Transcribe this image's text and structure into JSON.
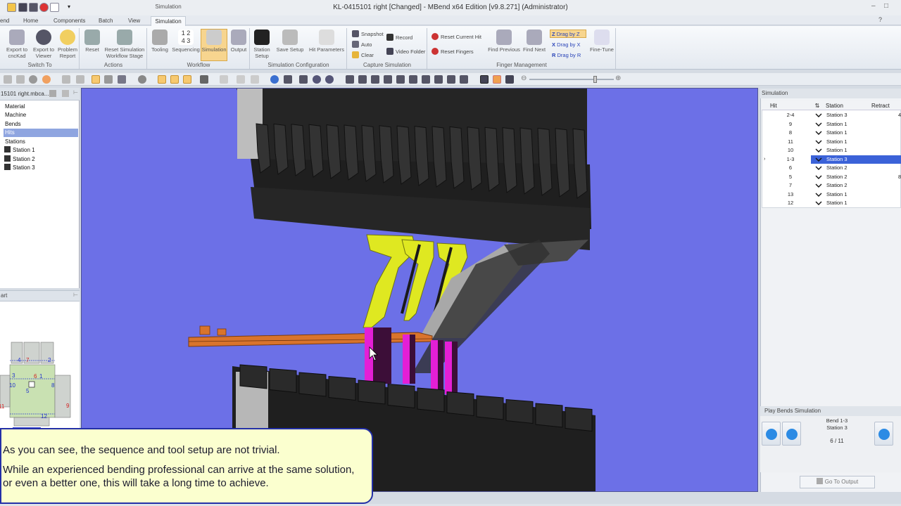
{
  "window": {
    "title": "KL-0415101 right [Changed] - MBend x64 Edition [v9.8.271] (Administrator)",
    "context_tab_label": "Simulation"
  },
  "menu_tabs": [
    "end",
    "Home",
    "Components",
    "Batch",
    "View",
    "Simulation"
  ],
  "ribbon": {
    "switch_to": {
      "label": "Switch To",
      "buttons": [
        "Export to cncKad",
        "Export to Viewer",
        "Problem Report"
      ]
    },
    "actions": {
      "label": "Actions",
      "buttons": [
        "Reset",
        "Reset Simulation Workflow Stage"
      ]
    },
    "workflow": {
      "label": "Workflow",
      "buttons": [
        "Tooling",
        "Sequencing",
        "Simulation",
        "Output"
      ]
    },
    "sim_config": {
      "label": "Simulation Configuration",
      "buttons": [
        "Station Setup",
        "Save Setup",
        "Hit Parameters"
      ]
    },
    "capture": {
      "label": "Capture Simulation",
      "buttons": [
        "Snapshot",
        "Auto",
        "Clear",
        "Record",
        "Video Folder"
      ]
    },
    "finger": {
      "label": "Finger Management",
      "buttons": [
        "Reset Current Hit",
        "Reset Fingers",
        "Find Previous",
        "Find Next",
        "Drag by Z",
        "Drag by X",
        "Drag by R",
        "Fine-Tune"
      ]
    }
  },
  "left_panel": {
    "file_name": "15101 right.mbca...",
    "tree": [
      "Material",
      "Machine",
      "Bends",
      "Hits",
      "Stations",
      "Station 1",
      "Station 2",
      "Station 3"
    ],
    "part_panel_label": "art",
    "part_numbers": [
      "4",
      "7",
      "2",
      "3",
      "6",
      "1",
      "10",
      "5",
      "8",
      "11",
      "12",
      "9"
    ]
  },
  "simulation_panel": {
    "title": "Simulation",
    "columns": [
      "Hit",
      "Station",
      "Retract"
    ],
    "rows": [
      {
        "hit": "2-4",
        "station": "Station 3",
        "retract": "4"
      },
      {
        "hit": "9",
        "station": "Station 1",
        "retract": ""
      },
      {
        "hit": "8",
        "station": "Station 1",
        "retract": ""
      },
      {
        "hit": "11",
        "station": "Station 1",
        "retract": ""
      },
      {
        "hit": "10",
        "station": "Station 1",
        "retract": ""
      },
      {
        "hit": "1-3",
        "station": "Station 3",
        "retract": ""
      },
      {
        "hit": "6",
        "station": "Station 2",
        "retract": ""
      },
      {
        "hit": "5",
        "station": "Station 2",
        "retract": "8"
      },
      {
        "hit": "7",
        "station": "Station 2",
        "retract": ""
      },
      {
        "hit": "13",
        "station": "Station 1",
        "retract": ""
      },
      {
        "hit": "12",
        "station": "Station 1",
        "retract": ""
      }
    ],
    "selected_row": 5
  },
  "play_panel": {
    "title": "Play Bends Simulation",
    "bend": "Bend 1-3",
    "station": "Station 3",
    "counter": "6 / 11",
    "goto_label": "Go To Output"
  },
  "note": {
    "line1": "As you can see, the sequence and tool setup are not trivial.",
    "line2": "While an experienced bending professional can arrive at the same solution, or even a better one, this will take a long time to achieve."
  },
  "colors": {
    "viewport_bg": "#6c70e7",
    "selected_row": "#3b62d8",
    "note_bg": "#fbffcf",
    "note_border": "#232fa7",
    "punch_yellow": "#dfe821",
    "gripper_magenta": "#e41fd6",
    "sheet_orange": "#d9742c"
  }
}
